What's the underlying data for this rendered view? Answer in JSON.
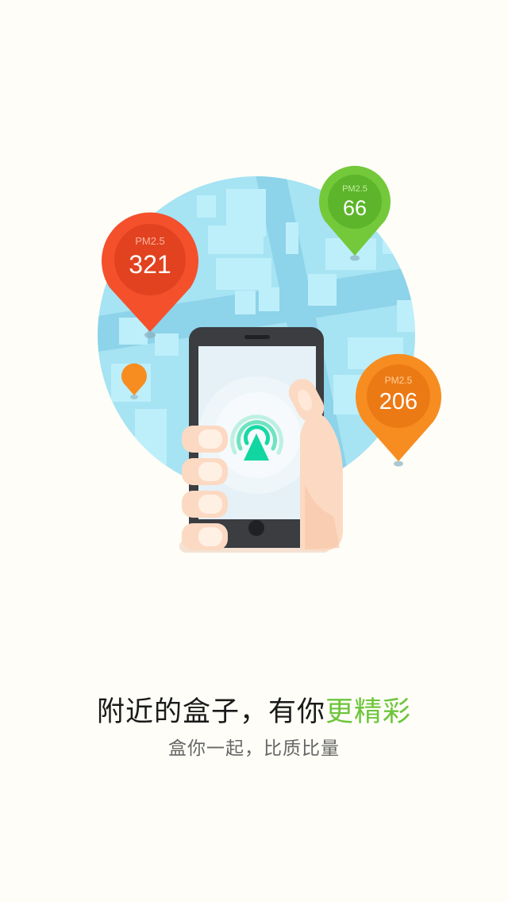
{
  "illustration": {
    "pins": [
      {
        "label": "PM2.5",
        "value": "321",
        "color": "#f4502c"
      },
      {
        "label": "PM2.5",
        "value": "66",
        "color": "#73c93a"
      },
      {
        "label": "PM2.5",
        "value": "206",
        "color": "#f78d21"
      }
    ],
    "icons": [
      "map-globe",
      "smartphone",
      "hand",
      "radar-location-icon",
      "map-pin-icon"
    ]
  },
  "headline": {
    "text": "附近的盒子，有你",
    "accent": "更精彩",
    "accent_color": "#6cc53a"
  },
  "subline": {
    "text": "盒你一起，比质比量"
  },
  "colors": {
    "background": "#fefdf7",
    "map": "#a6e3f3"
  }
}
